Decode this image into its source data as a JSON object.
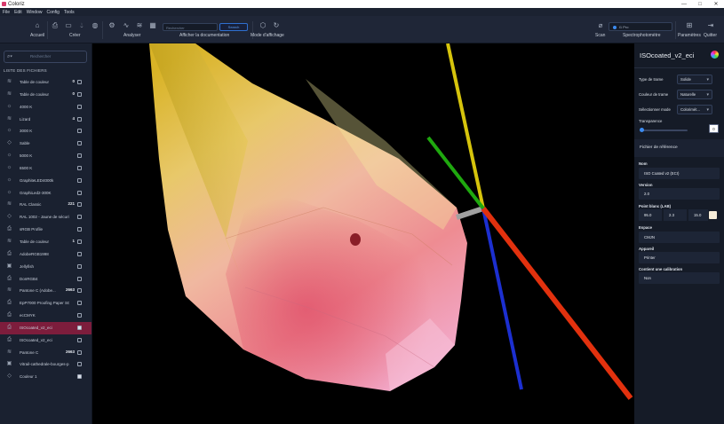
{
  "window": {
    "title": "Coloriz",
    "controls": [
      "—",
      "□",
      "✕"
    ]
  },
  "menu": [
    "File",
    "Edit",
    "Window",
    "Config",
    "Tools"
  ],
  "toolbar": {
    "accueil": "Accueil",
    "creer": "Créer",
    "analyser": "Analyser",
    "afficher_doc": "Afficher la documentation",
    "mode_affichage": "Mode d'affichage",
    "search_placeholder": "Rechercher",
    "search_button": "Search",
    "scan": "Scan",
    "spectro": "Spectrophotomètre",
    "device": "i1 Pro",
    "parametres": "Paramètres",
    "quitter": "Quitter"
  },
  "sidebar": {
    "search_placeholder": "Rechercher",
    "header": "LISTE DES FICHIERS",
    "items": [
      {
        "icon": "layers-icon",
        "label": "Table de couleur",
        "count": "0",
        "checked": false,
        "active": false
      },
      {
        "icon": "layers-icon",
        "label": "Table de couleur",
        "count": "0",
        "checked": false,
        "active": false
      },
      {
        "icon": "sun-icon",
        "label": "4000 K",
        "count": "",
        "checked": false,
        "active": false
      },
      {
        "icon": "layers-icon",
        "label": "Lizard",
        "count": "4",
        "checked": false,
        "active": false
      },
      {
        "icon": "sun-icon",
        "label": "3000 K",
        "count": "",
        "checked": false,
        "active": false
      },
      {
        "icon": "drop-icon",
        "label": "Sable",
        "count": "",
        "checked": false,
        "active": false
      },
      {
        "icon": "sun-icon",
        "label": "5000 K",
        "count": "",
        "checked": false,
        "active": false
      },
      {
        "icon": "sun-icon",
        "label": "6500 K",
        "count": "",
        "checked": false,
        "active": false
      },
      {
        "icon": "sun-icon",
        "label": "GraphiteLED4000k",
        "count": "",
        "checked": false,
        "active": false
      },
      {
        "icon": "sun-icon",
        "label": "GraphiLed2-300K",
        "count": "",
        "checked": false,
        "active": false
      },
      {
        "icon": "layers-icon",
        "label": "RAL Classic",
        "count": "221",
        "checked": false,
        "active": false
      },
      {
        "icon": "drop-icon",
        "label": "RAL 1002 - Jaune de sécurité",
        "count": "",
        "checked": false,
        "active": false
      },
      {
        "icon": "printer-icon",
        "label": "sRGB Profile",
        "count": "",
        "checked": false,
        "active": false
      },
      {
        "icon": "layers-icon",
        "label": "Table de couleur",
        "count": "1",
        "checked": false,
        "active": false
      },
      {
        "icon": "printer-icon",
        "label": "AdobeRGB1998",
        "count": "",
        "checked": false,
        "active": false
      },
      {
        "icon": "image-icon",
        "label": "Jellyfish",
        "count": "",
        "checked": false,
        "active": false
      },
      {
        "icon": "printer-icon",
        "label": "DonRGB4",
        "count": "",
        "checked": false,
        "active": false
      },
      {
        "icon": "layers-icon",
        "label": "Pantone C (Adobe...",
        "count": "2663",
        "checked": false,
        "active": false
      },
      {
        "icon": "printer-icon",
        "label": "EpP7000 Proofing Paper SG...",
        "count": "",
        "checked": false,
        "active": false
      },
      {
        "icon": "printer-icon",
        "label": "ecCMYK",
        "count": "",
        "checked": false,
        "active": false
      },
      {
        "icon": "printer-icon",
        "label": "ISOcoated_v2_eci",
        "count": "",
        "checked": true,
        "active": true
      },
      {
        "icon": "printer-icon",
        "label": "ISOcoated_v2_eci",
        "count": "",
        "checked": false,
        "active": false
      },
      {
        "icon": "layers-icon",
        "label": "Pantone C",
        "count": "2663",
        "checked": false,
        "active": false
      },
      {
        "icon": "image-icon",
        "label": "Vitrail-cathedrale-bourges-p...",
        "count": "",
        "checked": false,
        "active": false
      },
      {
        "icon": "drop-icon",
        "label": "Couleur 1",
        "count": "",
        "checked": true,
        "active": false
      }
    ]
  },
  "right_panel": {
    "title": "ISOcoated_v2_eci",
    "type_trame_label": "Type de trame",
    "type_trame_value": "Solide",
    "couleur_trame_label": "Couleur de trame",
    "couleur_trame_value": "Naturelle",
    "mode_label": "Sélectionner mode",
    "mode_value": "Colorimét...",
    "transparence_label": "Transparence",
    "transparence_value": "0",
    "transparence_fraction": 0.0,
    "section_title": "Fichier de référence",
    "nom_label": "Nom",
    "nom_value": "ISO Coated v2 (ECI)",
    "version_label": "Version",
    "version_value": "2.0",
    "point_blanc_label": "Point blanc (LAB)",
    "point_blanc_l": "95.0",
    "point_blanc_a": "2.3",
    "point_blanc_b": "15.0",
    "point_blanc_swatch": "#f6ecd8",
    "espace_label": "Espace",
    "espace_value": "CMJN",
    "appareil_label": "Appareil",
    "appareil_value": "Printer",
    "calibration_label": "Contient une calibration",
    "calibration_value": "Non"
  },
  "colors": {
    "accent": "#3c8bf0",
    "active_item": "#7d1d3c",
    "brand": "#d63a6c"
  }
}
